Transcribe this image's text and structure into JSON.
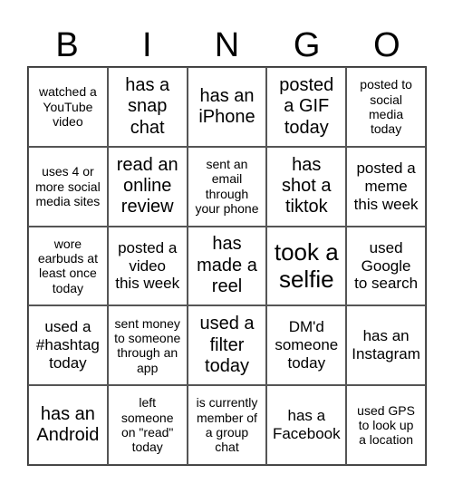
{
  "header": [
    "B",
    "I",
    "N",
    "G",
    "O"
  ],
  "cells": [
    {
      "text": "watched a\nYouTube\nvideo",
      "size": "s"
    },
    {
      "text": "has a\nsnap\nchat",
      "size": "l"
    },
    {
      "text": "has an\niPhone",
      "size": "l"
    },
    {
      "text": "posted\na GIF\ntoday",
      "size": "l"
    },
    {
      "text": "posted to\nsocial\nmedia\ntoday",
      "size": "s"
    },
    {
      "text": "uses 4 or\nmore social\nmedia sites",
      "size": "s"
    },
    {
      "text": "read an\nonline\nreview",
      "size": "l"
    },
    {
      "text": "sent an\nemail\nthrough\nyour phone",
      "size": "s"
    },
    {
      "text": "has\nshot a\ntiktok",
      "size": "l"
    },
    {
      "text": "posted a\nmeme\nthis week",
      "size": "m"
    },
    {
      "text": "wore\nearbuds at\nleast once\ntoday",
      "size": "s"
    },
    {
      "text": "posted a\nvideo\nthis week",
      "size": "m"
    },
    {
      "text": "has\nmade a\nreel",
      "size": "l"
    },
    {
      "text": "took a\nselfie",
      "size": "xl"
    },
    {
      "text": "used\nGoogle\nto search",
      "size": "m"
    },
    {
      "text": "used a\n#hashtag\ntoday",
      "size": "m"
    },
    {
      "text": "sent money\nto someone\nthrough an\napp",
      "size": "s"
    },
    {
      "text": "used a\nfilter\ntoday",
      "size": "l"
    },
    {
      "text": "DM'd\nsomeone\ntoday",
      "size": "m"
    },
    {
      "text": "has an\nInstagram",
      "size": "m"
    },
    {
      "text": "has an\nAndroid",
      "size": "l"
    },
    {
      "text": "left\nsomeone\non \"read\"\ntoday",
      "size": "s"
    },
    {
      "text": "is currently\nmember of\na group\nchat",
      "size": "s"
    },
    {
      "text": "has a\nFacebook",
      "size": "m"
    },
    {
      "text": "used GPS\nto look up\na location",
      "size": "s"
    }
  ]
}
